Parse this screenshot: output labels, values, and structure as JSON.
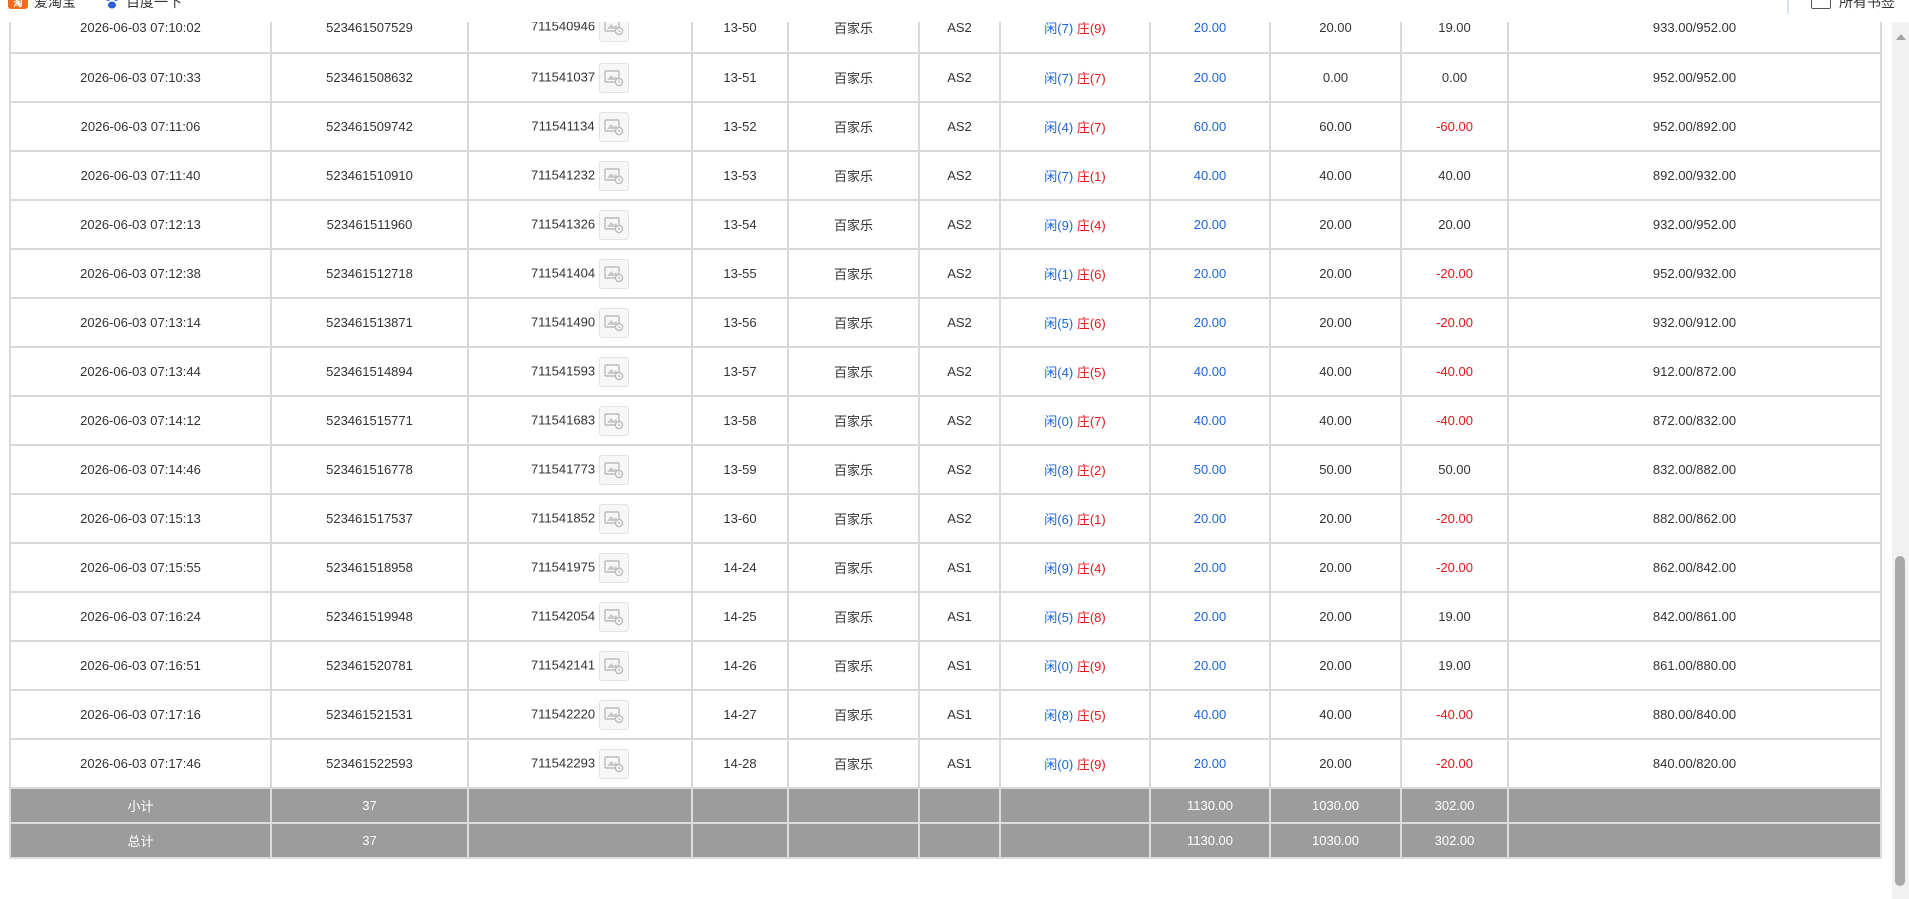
{
  "bookmarks": {
    "item1_label": "爱淘宝",
    "item2_label": "百度一下",
    "all_bookmarks": "所有书签"
  },
  "rows": [
    {
      "time": "2026-06-03 07:10:02",
      "bet_id": "523461507529",
      "game_id": "711540946",
      "table": "13-50",
      "game": "百家乐",
      "room": "AS2",
      "xian": "闲(7)",
      "zhuang": "庄(9)",
      "bet": "20.00",
      "valid": "20.00",
      "win": "19.00",
      "win_neg": false,
      "balance": "933.00/952.00"
    },
    {
      "time": "2026-06-03 07:10:33",
      "bet_id": "523461508632",
      "game_id": "711541037",
      "table": "13-51",
      "game": "百家乐",
      "room": "AS2",
      "xian": "闲(7)",
      "zhuang": "庄(7)",
      "bet": "20.00",
      "valid": "0.00",
      "win": "0.00",
      "win_neg": false,
      "balance": "952.00/952.00"
    },
    {
      "time": "2026-06-03 07:11:06",
      "bet_id": "523461509742",
      "game_id": "711541134",
      "table": "13-52",
      "game": "百家乐",
      "room": "AS2",
      "xian": "闲(4)",
      "zhuang": "庄(7)",
      "bet": "60.00",
      "valid": "60.00",
      "win": "-60.00",
      "win_neg": true,
      "balance": "952.00/892.00"
    },
    {
      "time": "2026-06-03 07:11:40",
      "bet_id": "523461510910",
      "game_id": "711541232",
      "table": "13-53",
      "game": "百家乐",
      "room": "AS2",
      "xian": "闲(7)",
      "zhuang": "庄(1)",
      "bet": "40.00",
      "valid": "40.00",
      "win": "40.00",
      "win_neg": false,
      "balance": "892.00/932.00"
    },
    {
      "time": "2026-06-03 07:12:13",
      "bet_id": "523461511960",
      "game_id": "711541326",
      "table": "13-54",
      "game": "百家乐",
      "room": "AS2",
      "xian": "闲(9)",
      "zhuang": "庄(4)",
      "bet": "20.00",
      "valid": "20.00",
      "win": "20.00",
      "win_neg": false,
      "balance": "932.00/952.00"
    },
    {
      "time": "2026-06-03 07:12:38",
      "bet_id": "523461512718",
      "game_id": "711541404",
      "table": "13-55",
      "game": "百家乐",
      "room": "AS2",
      "xian": "闲(1)",
      "zhuang": "庄(6)",
      "bet": "20.00",
      "valid": "20.00",
      "win": "-20.00",
      "win_neg": true,
      "balance": "952.00/932.00"
    },
    {
      "time": "2026-06-03 07:13:14",
      "bet_id": "523461513871",
      "game_id": "711541490",
      "table": "13-56",
      "game": "百家乐",
      "room": "AS2",
      "xian": "闲(5)",
      "zhuang": "庄(6)",
      "bet": "20.00",
      "valid": "20.00",
      "win": "-20.00",
      "win_neg": true,
      "balance": "932.00/912.00"
    },
    {
      "time": "2026-06-03 07:13:44",
      "bet_id": "523461514894",
      "game_id": "711541593",
      "table": "13-57",
      "game": "百家乐",
      "room": "AS2",
      "xian": "闲(4)",
      "zhuang": "庄(5)",
      "bet": "40.00",
      "valid": "40.00",
      "win": "-40.00",
      "win_neg": true,
      "balance": "912.00/872.00"
    },
    {
      "time": "2026-06-03 07:14:12",
      "bet_id": "523461515771",
      "game_id": "711541683",
      "table": "13-58",
      "game": "百家乐",
      "room": "AS2",
      "xian": "闲(0)",
      "zhuang": "庄(7)",
      "bet": "40.00",
      "valid": "40.00",
      "win": "-40.00",
      "win_neg": true,
      "balance": "872.00/832.00"
    },
    {
      "time": "2026-06-03 07:14:46",
      "bet_id": "523461516778",
      "game_id": "711541773",
      "table": "13-59",
      "game": "百家乐",
      "room": "AS2",
      "xian": "闲(8)",
      "zhuang": "庄(2)",
      "bet": "50.00",
      "valid": "50.00",
      "win": "50.00",
      "win_neg": false,
      "balance": "832.00/882.00"
    },
    {
      "time": "2026-06-03 07:15:13",
      "bet_id": "523461517537",
      "game_id": "711541852",
      "table": "13-60",
      "game": "百家乐",
      "room": "AS2",
      "xian": "闲(6)",
      "zhuang": "庄(1)",
      "bet": "20.00",
      "valid": "20.00",
      "win": "-20.00",
      "win_neg": true,
      "balance": "882.00/862.00"
    },
    {
      "time": "2026-06-03 07:15:55",
      "bet_id": "523461518958",
      "game_id": "711541975",
      "table": "14-24",
      "game": "百家乐",
      "room": "AS1",
      "xian": "闲(9)",
      "zhuang": "庄(4)",
      "bet": "20.00",
      "valid": "20.00",
      "win": "-20.00",
      "win_neg": true,
      "balance": "862.00/842.00"
    },
    {
      "time": "2026-06-03 07:16:24",
      "bet_id": "523461519948",
      "game_id": "711542054",
      "table": "14-25",
      "game": "百家乐",
      "room": "AS1",
      "xian": "闲(5)",
      "zhuang": "庄(8)",
      "bet": "20.00",
      "valid": "20.00",
      "win": "19.00",
      "win_neg": false,
      "balance": "842.00/861.00"
    },
    {
      "time": "2026-06-03 07:16:51",
      "bet_id": "523461520781",
      "game_id": "711542141",
      "table": "14-26",
      "game": "百家乐",
      "room": "AS1",
      "xian": "闲(0)",
      "zhuang": "庄(9)",
      "bet": "20.00",
      "valid": "20.00",
      "win": "19.00",
      "win_neg": false,
      "balance": "861.00/880.00"
    },
    {
      "time": "2026-06-03 07:17:16",
      "bet_id": "523461521531",
      "game_id": "711542220",
      "table": "14-27",
      "game": "百家乐",
      "room": "AS1",
      "xian": "闲(8)",
      "zhuang": "庄(5)",
      "bet": "40.00",
      "valid": "40.00",
      "win": "-40.00",
      "win_neg": true,
      "balance": "880.00/840.00"
    },
    {
      "time": "2026-06-03 07:17:46",
      "bet_id": "523461522593",
      "game_id": "711542293",
      "table": "14-28",
      "game": "百家乐",
      "room": "AS1",
      "xian": "闲(0)",
      "zhuang": "庄(9)",
      "bet": "20.00",
      "valid": "20.00",
      "win": "-20.00",
      "win_neg": true,
      "balance": "840.00/820.00"
    }
  ],
  "subtotal": {
    "label": "小计",
    "count": "37",
    "bet": "1130.00",
    "valid": "1030.00",
    "win": "302.00"
  },
  "total": {
    "label": "总计",
    "count": "37",
    "bet": "1130.00",
    "valid": "1030.00",
    "win": "302.00"
  },
  "colors": {
    "blue": "#1a66d9",
    "red": "#e4171c",
    "summary_bg": "#9c9c9c"
  }
}
